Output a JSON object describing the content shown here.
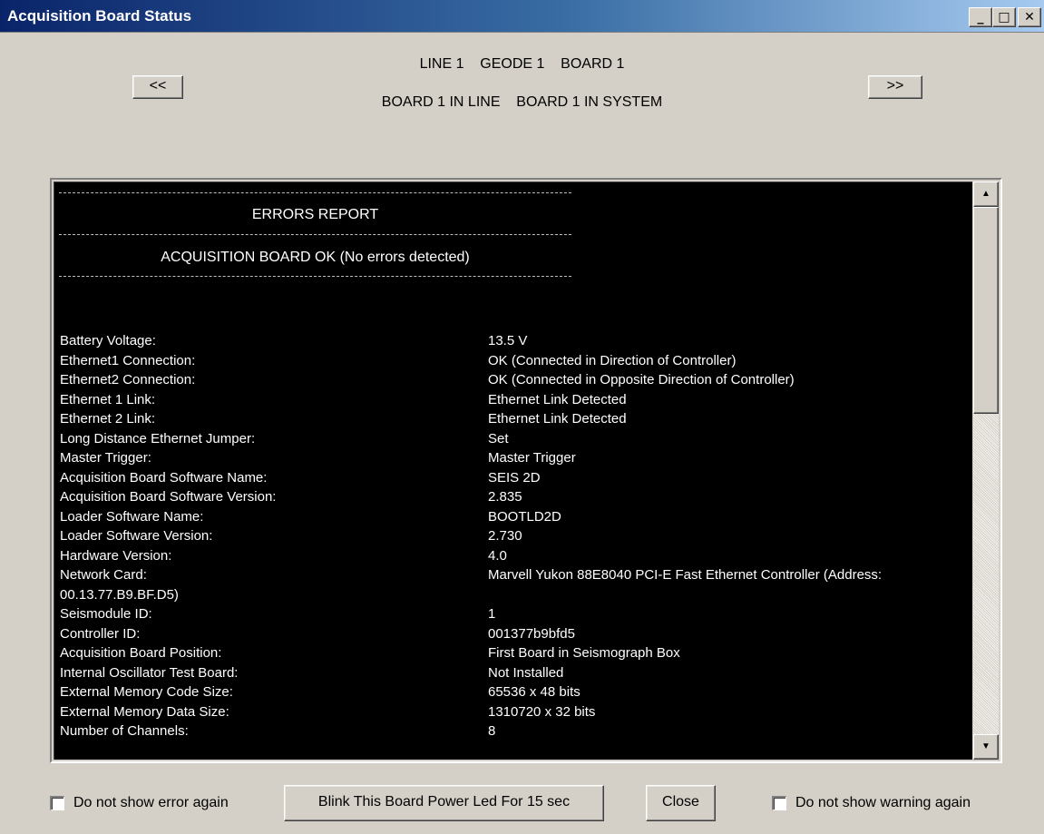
{
  "window": {
    "title": "Acquisition Board Status",
    "controls": {
      "minimize": "_",
      "maximize": "□",
      "close": "✕"
    }
  },
  "nav": {
    "prev_label": "<<",
    "next_label": ">>",
    "header_line1": "LINE 1    GEODE 1    BOARD 1",
    "header_line2": "BOARD 1 IN LINE    BOARD 1 IN SYSTEM"
  },
  "report": {
    "title": "ERRORS REPORT",
    "status": "ACQUISITION BOARD OK (No errors detected)",
    "rows": [
      {
        "key": "Battery Voltage:",
        "value": "13.5 V"
      },
      {
        "key": "Ethernet1 Connection:",
        "value": "OK (Connected in Direction of Controller)"
      },
      {
        "key": "Ethernet2 Connection:",
        "value": "OK (Connected in Opposite Direction of Controller)"
      },
      {
        "key": "Ethernet 1 Link:",
        "value": "Ethernet Link Detected"
      },
      {
        "key": "Ethernet 2 Link:",
        "value": "Ethernet Link Detected"
      },
      {
        "key": "Long Distance Ethernet Jumper:",
        "value": "Set"
      },
      {
        "key": "Master Trigger:",
        "value": "Master Trigger"
      },
      {
        "key": "Acquisition Board Software Name:",
        "value": "SEIS 2D"
      },
      {
        "key": "Acquisition Board Software Version:",
        "value": "2.835"
      },
      {
        "key": "Loader Software Name:",
        "value": "BOOTLD2D"
      },
      {
        "key": "Loader Software Version:",
        "value": "2.730"
      },
      {
        "key": "Hardware Version:",
        "value": "4.0"
      },
      {
        "key": "Network Card:",
        "value": "Marvell Yukon 88E8040 PCI-E Fast Ethernet Controller  (Address:",
        "continuation": "00.13.77.B9.BF.D5)"
      },
      {
        "key": "Seismodule ID:",
        "value": "1"
      },
      {
        "key": "Controller ID:",
        "value": "001377b9bfd5"
      },
      {
        "key": "Acquisition Board Position:",
        "value": "First Board in Seismograph Box"
      },
      {
        "key": "Internal Oscillator Test Board:",
        "value": "Not Installed"
      },
      {
        "key": "External Memory Code Size:",
        "value": "65536 x 48 bits"
      },
      {
        "key": "External Memory Data Size:",
        "value": "1310720 x 32 bits"
      },
      {
        "key": "Number of Channels:",
        "value": "8"
      }
    ]
  },
  "scrollbar": {
    "up_arrow": "▲",
    "down_arrow": "▼"
  },
  "footer": {
    "error_checkbox_label": "Do not show error again",
    "error_checked": false,
    "blink_button_label": "Blink This Board Power Led For 15 sec",
    "close_button_label": "Close",
    "warning_checkbox_label": "Do not show warning again",
    "warning_checked": false
  }
}
